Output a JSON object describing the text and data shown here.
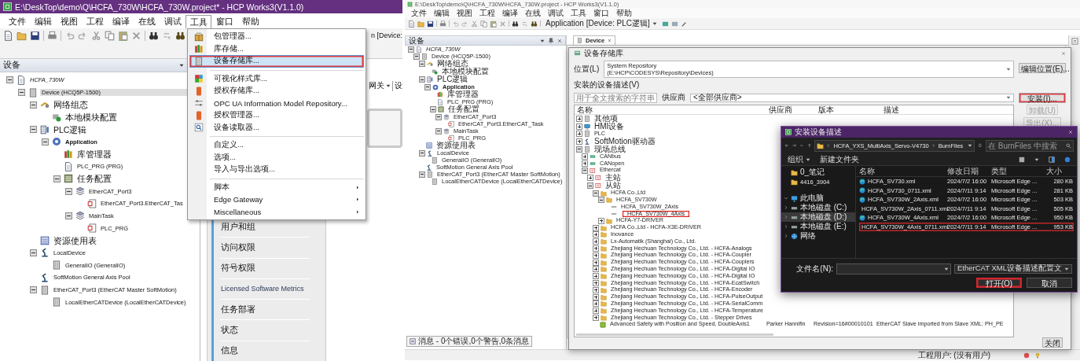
{
  "left_window": {
    "title": "E:\\DeskTop\\demo\\Q\\HCFA_730W\\HCFA_730W.project* - HCP Works3(V1.1.0)",
    "menu": [
      {
        "label": "文件",
        "selected": false
      },
      {
        "label": "编辑",
        "selected": false
      },
      {
        "label": "视图",
        "selected": false
      },
      {
        "label": "工程",
        "selected": false
      },
      {
        "label": "编译",
        "selected": false
      },
      {
        "label": "在线",
        "selected": false
      },
      {
        "label": "调试",
        "selected": false
      },
      {
        "label": "工具",
        "selected": true
      },
      {
        "label": "窗口",
        "selected": false
      },
      {
        "label": "帮助",
        "selected": false
      }
    ],
    "toolbar_text": "n [Device:",
    "device_pane": {
      "title": "设备",
      "tree": [
        {
          "label": "HCFA_730W",
          "kind": "project",
          "selected": false,
          "expanded": true,
          "children": [
            {
              "label": "Device (HCQ5P-1500)",
              "kind": "device",
              "selected": true,
              "expanded": true,
              "children": [
                {
                  "label": "网络组态",
                  "kind": "network",
                  "selected": false,
                  "expanded": true,
                  "children": [
                    {
                      "label": "本地模块配置",
                      "kind": "module",
                      "selected": false
                    }
                  ]
                },
                {
                  "label": "PLC逻辑",
                  "kind": "plc",
                  "selected": false,
                  "expanded": true,
                  "children": [
                    {
                      "label": "Application",
                      "kind": "application",
                      "selected": false,
                      "expanded": true,
                      "children": [
                        {
                          "label": "库管理器",
                          "kind": "library",
                          "selected": false
                        },
                        {
                          "label": "PLC_PRG (PRG)",
                          "kind": "program",
                          "selected": false
                        },
                        {
                          "label": "任务配置",
                          "kind": "tasks",
                          "selected": false,
                          "expanded": true,
                          "children": [
                            {
                              "label": "EtherCAT_Port3",
                              "kind": "task",
                              "selected": false,
                              "expanded": true,
                              "children": [
                                {
                                  "label": "EtherCAT_Port3.EtherCAT_Tas",
                                  "kind": "call",
                                  "selected": false
                                }
                              ]
                            },
                            {
                              "label": "MainTask",
                              "kind": "task",
                              "selected": false,
                              "expanded": true,
                              "children": [
                                {
                                  "label": "PLC_PRG",
                                  "kind": "call",
                                  "selected": false
                                }
                              ]
                            }
                          ]
                        }
                      ]
                    }
                  ]
                },
                {
                  "label": "资源使用表",
                  "kind": "table",
                  "selected": false
                },
                {
                  "label": "LocalDevice",
                  "kind": "axis",
                  "selected": false,
                  "expanded": true,
                  "children": [
                    {
                      "label": "GeneralIO (GeneralIO)",
                      "kind": "device",
                      "selected": false
                    }
                  ]
                },
                {
                  "label": "SoftMotion General Axis Pool",
                  "kind": "axis",
                  "selected": false
                },
                {
                  "label": "EtherCAT_Port3 (EtherCAT Master SoftMotion)",
                  "kind": "device",
                  "selected": false,
                  "expanded": true,
                  "children": [
                    {
                      "label": "LocalEtherCATDevice (LocalEtherCATDevice)",
                      "kind": "device",
                      "selected": false
                    }
                  ]
                }
              ]
            }
          ]
        }
      ]
    },
    "editor": {
      "dropdown": "网关",
      "tab_cut": "设",
      "side_list": [
        "用户和组",
        "访问权限",
        "符号权限",
        "Licensed Software Metrics",
        "任务部署",
        "状态",
        "信息"
      ]
    },
    "tools_menu": {
      "groups": [
        {
          "items": [
            {
              "label": "包管理器...",
              "selected": false,
              "marked": false,
              "submenu": false
            },
            {
              "label": "库存储...",
              "selected": false,
              "marked": false,
              "submenu": false
            },
            {
              "label": "设备存储库...",
              "selected": true,
              "marked": true,
              "submenu": false
            }
          ]
        },
        {
          "items": [
            {
              "label": "可视化样式库...",
              "selected": false,
              "marked": false,
              "submenu": false
            },
            {
              "label": "授权存储库...",
              "selected": false,
              "marked": false,
              "submenu": false
            },
            {
              "label": "OPC UA Information Model Repository...",
              "selected": false,
              "marked": false,
              "submenu": false
            },
            {
              "label": "授权管理器...",
              "selected": false,
              "marked": false,
              "submenu": false
            },
            {
              "label": "设备读取器...",
              "selected": false,
              "marked": false,
              "submenu": false
            }
          ]
        },
        {
          "items": [
            {
              "label": "自定义...",
              "selected": false,
              "marked": false,
              "submenu": false
            },
            {
              "label": "选项...",
              "selected": false,
              "marked": false,
              "submenu": false
            },
            {
              "label": "导入与导出选项...",
              "selected": false,
              "marked": false,
              "submenu": false
            }
          ]
        },
        {
          "items": [
            {
              "label": "脚本",
              "selected": false,
              "marked": false,
              "submenu": true
            },
            {
              "label": "Edge Gateway",
              "selected": false,
              "marked": false,
              "submenu": true
            },
            {
              "label": "Miscellaneous",
              "selected": false,
              "marked": false,
              "submenu": true
            }
          ]
        }
      ]
    }
  },
  "right_window": {
    "title": "E:\\DeskTop\\demo\\Q\\HCFA_730W\\HCFA_730W.project - HCP Works3(V1.1.0)",
    "menu": [
      "文件",
      "编辑",
      "视图",
      "工程",
      "编译",
      "在线",
      "调试",
      "工具",
      "窗口",
      "帮助"
    ],
    "toolbar_text": "Application [Device: PLC逻辑]",
    "device_pane": {
      "title": "设备",
      "tree": [
        {
          "label": "HCFA_730W",
          "kind": "project",
          "expanded": true,
          "children": [
            {
              "label": "Device (HCQ5P-1500)",
              "kind": "device",
              "expanded": true,
              "children": [
                {
                  "label": "网络组态",
                  "kind": "network",
                  "expanded": true,
                  "children": [
                    {
                      "label": "本地模块配置",
                      "kind": "module"
                    }
                  ]
                },
                {
                  "label": "PLC逻辑",
                  "kind": "plc",
                  "expanded": true,
                  "children": [
                    {
                      "label": "Application",
                      "kind": "application",
                      "expanded": true,
                      "children": [
                        {
                          "label": "库管理器",
                          "kind": "library"
                        },
                        {
                          "label": "PLC_PRG (PRG)",
                          "kind": "program"
                        },
                        {
                          "label": "任务配置",
                          "kind": "tasks",
                          "expanded": true,
                          "children": [
                            {
                              "label": "EtherCAT_Port3",
                              "kind": "task",
                              "expanded": true,
                              "children": [
                                {
                                  "label": "EtherCAT_Port3.EtherCAT_Task",
                                  "kind": "call"
                                }
                              ]
                            },
                            {
                              "label": "MainTask",
                              "kind": "task",
                              "expanded": true,
                              "children": [
                                {
                                  "label": "PLC_PRG",
                                  "kind": "call"
                                }
                              ]
                            }
                          ]
                        }
                      ]
                    }
                  ]
                },
                {
                  "label": "资源使用表",
                  "kind": "table"
                },
                {
                  "label": "LocalDevice",
                  "kind": "axis",
                  "expanded": true,
                  "children": [
                    {
                      "label": "GeneralIO (GeneralIO)",
                      "kind": "device"
                    }
                  ]
                },
                {
                  "label": "SoftMotion General Axis Pool",
                  "kind": "axis"
                },
                {
                  "label": "EtherCAT_Port3 (EtherCAT Master SoftMotion)",
                  "kind": "device",
                  "expanded": true,
                  "children": [
                    {
                      "label": "LocalEtherCATDevice (LocalEtherCATDevice)",
                      "kind": "device"
                    }
                  ]
                }
              ]
            }
          ]
        }
      ],
      "messages": "消息 - 0个错误,0个警告,0条消息"
    },
    "editor_tab": "Device",
    "repository_dialog": {
      "title": "设备存储库",
      "location_label": "位置(L)",
      "location_name": "System Repository",
      "location_path": "(E:\\HCP\\CODESYS\\Repository\\Devices)",
      "edit_button": "编辑位置(E)...",
      "installed_label": "安装的设备描述(V)",
      "search_placeholder": "用于全文搜索的字符串",
      "vendor_label": "供应商",
      "vendor_value": "<全部供应商>",
      "columns": [
        "名称",
        "供应商",
        "版本",
        "描述"
      ],
      "tree": [
        {
          "label": "其他项",
          "kind": "device",
          "expanded": false
        },
        {
          "label": "HMI设备",
          "kind": "hmi",
          "expanded": false
        },
        {
          "label": "PLC",
          "kind": "device",
          "expanded": false
        },
        {
          "label": "SoftMotion驱动器",
          "kind": "axis",
          "expanded": false
        },
        {
          "label": "现场总线",
          "kind": "device",
          "expanded": true,
          "children": [
            {
              "label": "CANbus",
              "kind": "bus",
              "expanded": false
            },
            {
              "label": "CANopen",
              "kind": "bus",
              "expanded": false
            },
            {
              "label": "Ethercat",
              "kind": "ethercat",
              "expanded": true,
              "children": [
                {
                  "label": "主站",
                  "kind": "ethercat",
                  "expanded": false
                },
                {
                  "label": "从站",
                  "kind": "ethercat",
                  "expanded": true,
                  "children": [
                    {
                      "label": "HCFA Co.,Ltd",
                      "kind": "folder",
                      "expanded": true,
                      "children": [
                        {
                          "label": "HCFA_SV730W",
                          "kind": "folder",
                          "expanded": true,
                          "children": [
                            {
                              "label": "HCFA_SV730W_2Axis",
                              "kind": "slave",
                              "marked": false
                            },
                            {
                              "label": "HCFA_SV730W_4Axis",
                              "kind": "slave",
                              "marked": true
                            }
                          ]
                        },
                        {
                          "label": "HCFA-Y7-DRIVER",
                          "kind": "folder",
                          "expanded": false
                        }
                      ]
                    },
                    {
                      "label": "HCFA Co.,Ltd - HCFA-X3E-DRIVER",
                      "kind": "folder",
                      "expanded": false
                    },
                    {
                      "label": "Inovance",
                      "kind": "folder",
                      "expanded": false
                    },
                    {
                      "label": "Lx-Automatik (Shanghai) Co., Ltd.",
                      "kind": "folder",
                      "expanded": false
                    },
                    {
                      "label": "Zhejiang Hechuan Technology Co., Ltd. - HCFA-Analogs",
                      "kind": "folder",
                      "expanded": false
                    },
                    {
                      "label": "Zhejiang Hechuan Technology Co., Ltd. - HCFA-Coupler",
                      "kind": "folder",
                      "expanded": false
                    },
                    {
                      "label": "Zhejiang Hechuan Technology Co., Ltd. - HCFA-Couplers",
                      "kind": "folder",
                      "expanded": false
                    },
                    {
                      "label": "Zhejiang Hechuan Technology Co., Ltd. - HCFA-Digital IO",
                      "kind": "folder",
                      "expanded": false
                    },
                    {
                      "label": "Zhejiang Hechuan Technology Co., Ltd. - HCFA-Digital IO",
                      "kind": "folder",
                      "expanded": false
                    },
                    {
                      "label": "Zhejiang Hechuan Technology Co., Ltd. - HCFA-EcatSwitch",
                      "kind": "folder",
                      "expanded": false
                    },
                    {
                      "label": "Zhejiang Hechuan Technology Co., Ltd. - HCFA-Encoder",
                      "kind": "folder",
                      "expanded": false
                    },
                    {
                      "label": "Zhejiang Hechuan Technology Co., Ltd. - HCFA-PulseOutput",
                      "kind": "folder",
                      "expanded": false
                    },
                    {
                      "label": "Zhejiang Hechuan Technology Co., Ltd. - HCFA-SerialComm",
                      "kind": "folder",
                      "expanded": false
                    },
                    {
                      "label": "Zhejiang Hechuan Technology Co., Ltd. - HCFA-Temperature",
                      "kind": "folder",
                      "expanded": false
                    },
                    {
                      "label": "Zhejiang Hechuan Technology Co., Ltd. - Stepper Drives",
                      "kind": "folder",
                      "expanded": false
                    },
                    {
                      "label": "Advanced Safety with Position and Speed, DoubleAxis1",
                      "kind": "safety",
                      "vendor": "Parker Hannifin",
                      "version": "Revision=16#00010101",
                      "description": "EtherCAT Slave imported from Slave XML: PH_PE"
                    }
                  ]
                }
              ]
            }
          ]
        }
      ],
      "buttons": [
        {
          "label": "安装(I)...",
          "disabled": false,
          "marked": true
        },
        {
          "label": "卸载(U)",
          "disabled": true,
          "marked": false
        },
        {
          "label": "导出(X)...",
          "disabled": true,
          "marked": false
        }
      ],
      "close_button": "关闭"
    },
    "file_dialog": {
      "title": "安装设备描述",
      "breadcrumb": [
        "HCFA_YXS_MultiAxis_Servo-V4730",
        "BurnFiles"
      ],
      "search_placeholder": "在 BurnFiles 中搜索",
      "organize": "组织",
      "new_folder": "新建文件夹",
      "nav": [
        {
          "label": "0_笔记",
          "kind": "folder",
          "selected": false
        },
        {
          "label": "4416_3904",
          "kind": "folder",
          "selected": false
        },
        {
          "label": "此电脑",
          "kind": "computer",
          "selected": false,
          "expanded": true
        },
        {
          "label": "本地磁盘 (C:)",
          "kind": "drive",
          "selected": false,
          "expanded": false
        },
        {
          "label": "本地磁盘 (D:)",
          "kind": "drive",
          "selected": true,
          "expanded": false
        },
        {
          "label": "本地磁盘 (E:)",
          "kind": "drive",
          "selected": false,
          "expanded": false
        },
        {
          "label": "网络",
          "kind": "network",
          "selected": false,
          "expanded": false
        }
      ],
      "columns": [
        "名称",
        "修改日期",
        "类型",
        "大小"
      ],
      "files": [
        {
          "name": "HCFA_SV730.xml",
          "modified": "2024/7/2 16:00",
          "type": "Microsoft Edge ...",
          "size": "280 KB",
          "marked": false
        },
        {
          "name": "HCFA_SV730_0711.xml",
          "modified": "2024/7/11 9:14",
          "type": "Microsoft Edge ...",
          "size": "281 KB",
          "marked": false
        },
        {
          "name": "HCFA_SV730W_2Axis.xml",
          "modified": "2024/7/2 16:00",
          "type": "Microsoft Edge ...",
          "size": "503 KB",
          "marked": false
        },
        {
          "name": "HCFA_SV730W_2Axis_0711.xml",
          "modified": "2024/7/11 9:14",
          "type": "Microsoft Edge ...",
          "size": "505 KB",
          "marked": false
        },
        {
          "name": "HCFA_SV730W_4Axis.xml",
          "modified": "2024/7/2 16:00",
          "type": "Microsoft Edge ...",
          "size": "950 KB",
          "marked": false
        },
        {
          "name": "HCFA_SV730W_4Axis_0711.xml",
          "modified": "2024/7/11 9:14",
          "type": "Microsoft Edge ...",
          "size": "953 KB",
          "marked": true
        }
      ],
      "filename_label": "文件名(N):",
      "filter": "EtherCAT XML设备描述配置文",
      "buttons": [
        {
          "label": "打开(O)",
          "marked": true
        },
        {
          "label": "取消",
          "marked": false
        }
      ]
    },
    "status_bar": "工程用户: (没有用户)"
  }
}
